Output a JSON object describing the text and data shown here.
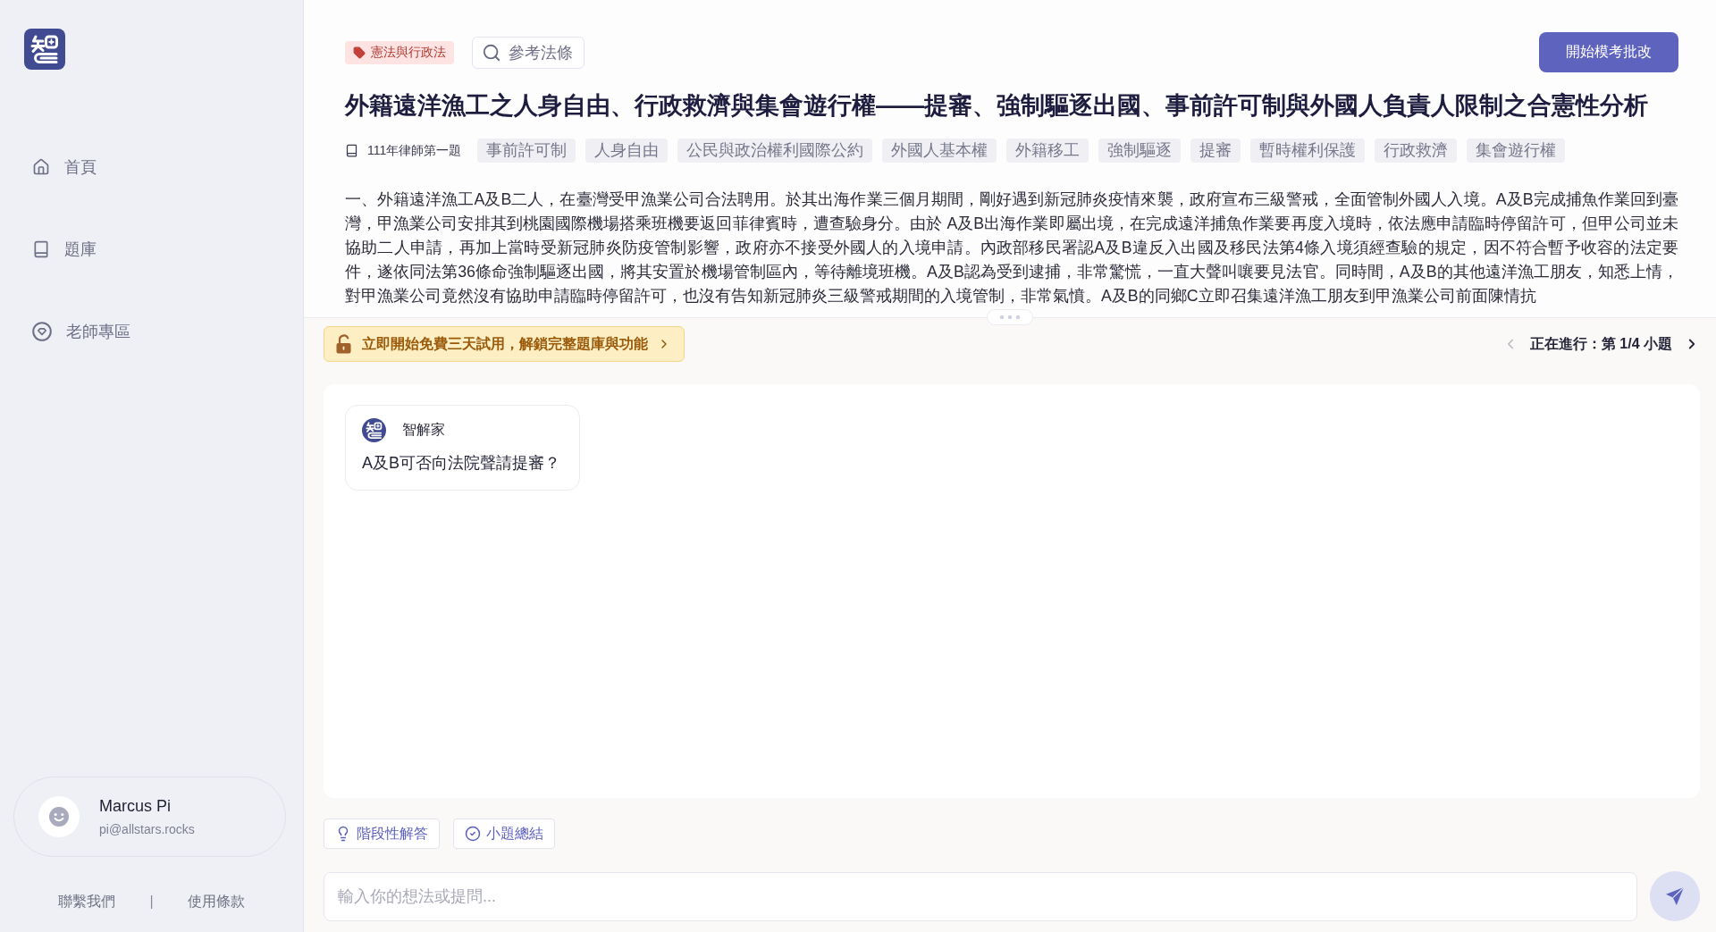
{
  "sidebar": {
    "nav": [
      {
        "kind": "home",
        "label": "首頁"
      },
      {
        "kind": "book",
        "label": "題庫"
      },
      {
        "kind": "gem",
        "label": "老師專區"
      }
    ],
    "user": {
      "name": "Marcus Pi",
      "email": "pi@allstars.rocks"
    },
    "footer": {
      "links": [
        "聯繫我們",
        "使用條款"
      ],
      "separator": "|"
    }
  },
  "header": {
    "category": "憲法與行政法",
    "reference_button": "參考法條",
    "start_button": "開始模考批改"
  },
  "question": {
    "title": "外籍遠洋漁工之人身自由、行政救濟與集會遊行權——提審、強制驅逐出國、事前許可制與外國人負責人限制之合憲性分析",
    "source": "111年律師第一題",
    "keywords": [
      "事前許可制",
      "人身自由",
      "公民與政治權利國際公約",
      "外國人基本權",
      "外籍移工",
      "強制驅逐",
      "提審",
      "暫時權利保護",
      "行政救濟",
      "集會遊行權"
    ],
    "body": "一、外籍遠洋漁工A及B二人，在臺灣受甲漁業公司合法聘用。於其出海作業三個月期間，剛好遇到新冠肺炎疫情來襲，政府宣布三級警戒，全面管制外國人入境。A及B完成捕魚作業回到臺灣，甲漁業公司安排其到桃園國際機場搭乘班機要返回菲律賓時，遭查驗身分。由於 A及B出海作業即屬出境，在完成遠洋捕魚作業要再度入境時，依法應申請臨時停留許可，但甲公司並未協助二人申請，再加上當時受新冠肺炎防疫管制影響，政府亦不接受外國人的入境申請。內政部移民署認A及B違反入出國及移民法第4條入境須經查驗的規定，因不符合暫予收容的法定要件，遂依同法第36條命強制驅逐出國，將其安置於機場管制區內，等待離境班機。A及B認為受到逮捕，非常驚慌，一直大聲叫嚷要見法官。同時間，A及B的其他遠洋漁工朋友，知悉上情，對甲漁業公司竟然沒有協助申請臨時停留許可，也沒有告知新冠肺炎三級警戒期間的入境管制，非常氣憤。A及B的同鄉C立即召集遠洋漁工朋友到甲漁業公司前面陳情抗"
  },
  "trial_banner": {
    "text": "立即開始免費三天試用，解鎖完整題庫與功能"
  },
  "pager": {
    "label": "正在進行：第 1/4 小題",
    "prev": {
      "disabled": true
    },
    "next": {
      "disabled": false
    }
  },
  "chat": {
    "messages": [
      {
        "sender": "智解家",
        "text": "A及B可否向法院聲請提審？"
      }
    ]
  },
  "actions": [
    {
      "kind": "hint",
      "label": "階段性解答"
    },
    {
      "kind": "summary",
      "label": "小題總結"
    }
  ],
  "composer": {
    "placeholder": "輸入你的想法或提問..."
  }
}
